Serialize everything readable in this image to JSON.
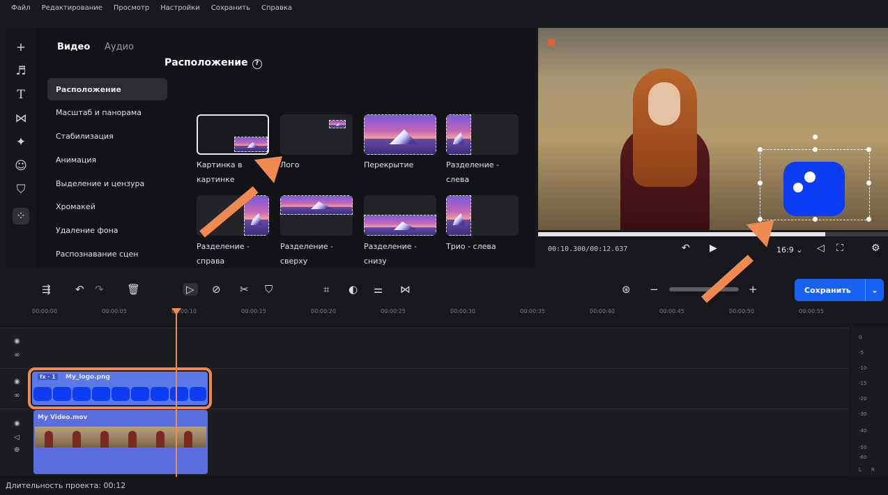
{
  "menu": [
    "Файл",
    "Редактирование",
    "Просмотр",
    "Настройки",
    "Сохранить",
    "Справка"
  ],
  "tabs": {
    "video": "Видео",
    "audio": "Аудио"
  },
  "sidebar": [
    {
      "label": "Расположение",
      "active": true
    },
    {
      "label": "Масштаб и панорама"
    },
    {
      "label": "Стабилизация"
    },
    {
      "label": "Анимация"
    },
    {
      "label": "Выделение и цензура"
    },
    {
      "label": "Хромакей"
    },
    {
      "label": "Удаление фона"
    },
    {
      "label": "Распознавание сцен"
    }
  ],
  "section_title": "Расположение",
  "layouts": [
    {
      "label": "Картинка в картинке",
      "selected": true
    },
    {
      "label": "Лого"
    },
    {
      "label": "Перекрытие"
    },
    {
      "label": "Разделение - слева"
    },
    {
      "label": "Разделение - справа"
    },
    {
      "label": "Разделение - сверху"
    },
    {
      "label": "Разделение - снизу"
    },
    {
      "label": "Трио - слева"
    }
  ],
  "player": {
    "timecode": "00:10.300/00:12.637",
    "progress": 0.82,
    "aspect": "16:9"
  },
  "toolbar": {
    "save_label": "Сохранить"
  },
  "ruler": [
    "00:00:00",
    "00:00:05",
    "00:00:10",
    "00:00:15",
    "00:00:20",
    "00:00:25",
    "00:00:30",
    "00:00:35",
    "00:00:40",
    "00:00:45",
    "00:00:50",
    "00:00:55"
  ],
  "clips": {
    "logo_badge": "fx · 1",
    "logo_name": "My_logo.png",
    "video_name": "My Video.mov"
  },
  "meter_labels": [
    "0",
    "-5",
    "-10",
    "-15",
    "-20",
    "-30",
    "-40",
    "-50",
    "-60",
    "L",
    "R"
  ],
  "status": {
    "duration": "Длительность проекта: 00:12"
  },
  "colors": {
    "accent": "#1862f2",
    "highlight": "#f08a50",
    "logo": "#0d3df2"
  }
}
